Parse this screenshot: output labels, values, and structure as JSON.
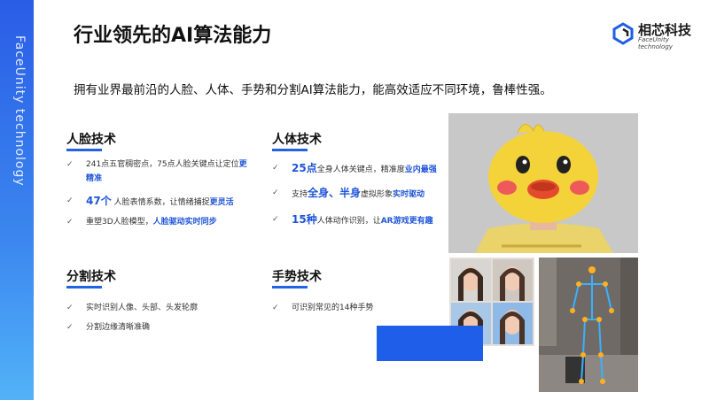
{
  "sidebar": {
    "vertical_text": "FaceUnity technology"
  },
  "title": "行业领先的AI算法能力",
  "logo": {
    "name": "相芯科技",
    "sub": "FaceUnity technology"
  },
  "subtitle": "拥有业界最前沿的人脸、人体、手势和分割AI算法能力，能高效适应不同环境，鲁棒性强。",
  "sections": {
    "face": {
      "title": "人脸技术",
      "items": [
        {
          "pre": "241点五官稠密点，75点人脸关键点让定位",
          "hl": "更精准",
          "post": ""
        },
        {
          "pre": "47个",
          "mid": "人脸表情系数，让情绪捕捉",
          "hl": "更灵活"
        },
        {
          "pre": "重塑3D人脸模型，",
          "hl": "人脸驱动实时同步"
        }
      ]
    },
    "body": {
      "title": "人体技术",
      "items": [
        {
          "pre": "25点",
          "mid": "全身人体关键点，精准度",
          "hl": "业内最强"
        },
        {
          "pre": "支持",
          "b1": "全身、半身",
          "mid": "虚拟形象",
          "hl": "实时驱动"
        },
        {
          "pre": "15种",
          "mid": "人体动作识别，让",
          "hl": "AR游戏更有趣"
        }
      ]
    },
    "seg": {
      "title": "分割技术",
      "items": [
        "实时识别人像、头部、头发轮廓",
        "分割边缘清晰准确"
      ]
    },
    "gesture": {
      "title": "手势技术",
      "items": [
        "可识别常见的14种手势"
      ]
    }
  },
  "check_symbol": "✓",
  "colors": {
    "accent": "#1f5ee8",
    "highlight": "#1f55d8"
  }
}
